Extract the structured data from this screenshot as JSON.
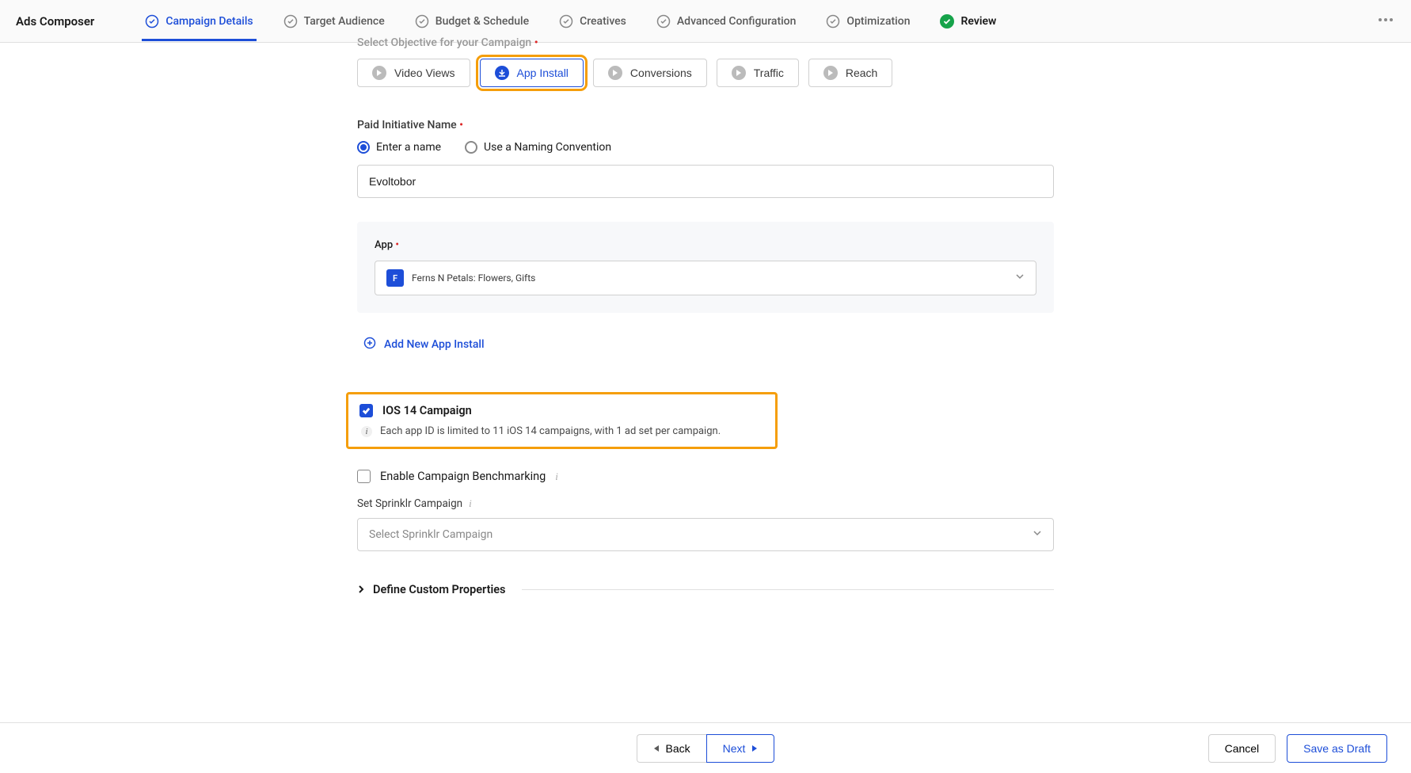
{
  "header": {
    "title": "Ads Composer",
    "steps": [
      {
        "label": "Campaign Details"
      },
      {
        "label": "Target Audience"
      },
      {
        "label": "Budget & Schedule"
      },
      {
        "label": "Creatives"
      },
      {
        "label": "Advanced Configuration"
      },
      {
        "label": "Optimization"
      },
      {
        "label": "Review"
      }
    ]
  },
  "form": {
    "objective_label": "Select Objective for your Campaign",
    "objectives": [
      {
        "label": "Video Views"
      },
      {
        "label": "App Install"
      },
      {
        "label": "Conversions"
      },
      {
        "label": "Traffic"
      },
      {
        "label": "Reach"
      }
    ],
    "initiative_label": "Paid Initiative Name",
    "radio_options": [
      {
        "label": "Enter a name"
      },
      {
        "label": "Use a Naming Convention"
      }
    ],
    "initiative_value": "Evoltobor",
    "app_label": "App",
    "app_icon_letter": "F",
    "app_name": "Ferns N Petals: Flowers, Gifts",
    "add_link": "Add New App Install",
    "ios_checkbox_label": "IOS 14 Campaign",
    "ios_info_text": "Each app ID is limited to 11 iOS 14 campaigns, with 1 ad set per campaign.",
    "benchmark_label": "Enable Campaign Benchmarking",
    "set_sprinklr_label": "Set Sprinklr Campaign",
    "sprinklr_placeholder": "Select Sprinklr Campaign",
    "expand_label": "Define Custom Properties"
  },
  "footer": {
    "back": "Back",
    "next": "Next",
    "cancel": "Cancel",
    "save_draft": "Save as Draft"
  }
}
